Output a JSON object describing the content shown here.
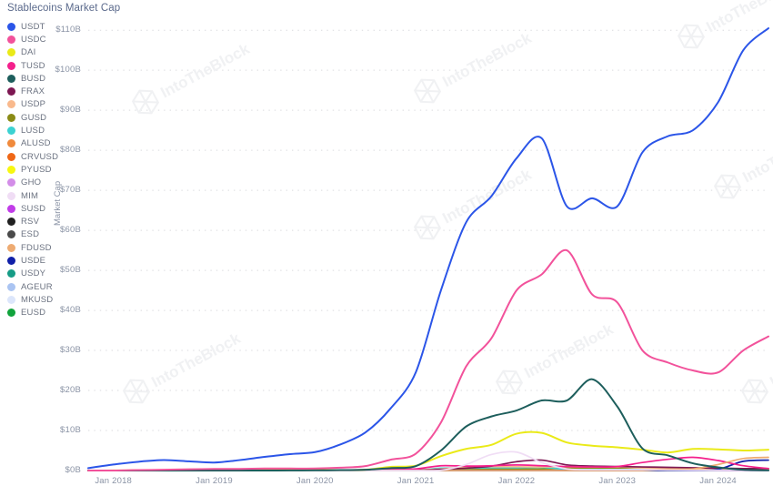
{
  "title": "Stablecoins Market Cap",
  "watermark": "IntoTheBlock",
  "axis": {
    "ylabel": "Market Cap",
    "yticks": [
      "$0B",
      "$10B",
      "$20B",
      "$30B",
      "$40B",
      "$50B",
      "$60B",
      "$70B",
      "$80B",
      "$90B",
      "$100B",
      "$110B"
    ],
    "xticks": [
      "Jan 2018",
      "Jan 2019",
      "Jan 2020",
      "Jan 2021",
      "Jan 2022",
      "Jan 2023",
      "Jan 2024"
    ]
  },
  "legend": [
    {
      "label": "USDT",
      "color": "#2b55e8"
    },
    {
      "label": "USDC",
      "color": "#f2529b"
    },
    {
      "label": "DAI",
      "color": "#eaea18"
    },
    {
      "label": "TUSD",
      "color": "#f4208c"
    },
    {
      "label": "BUSD",
      "color": "#1d5e5c"
    },
    {
      "label": "FRAX",
      "color": "#7d1752"
    },
    {
      "label": "USDP",
      "color": "#f9b98c"
    },
    {
      "label": "GUSD",
      "color": "#8a8b16"
    },
    {
      "label": "LUSD",
      "color": "#3cd2d2"
    },
    {
      "label": "ALUSD",
      "color": "#f08a3c"
    },
    {
      "label": "CRVUSD",
      "color": "#ef6716"
    },
    {
      "label": "PYUSD",
      "color": "#f7f711"
    },
    {
      "label": "GHO",
      "color": "#d38de8"
    },
    {
      "label": "MIM",
      "color": "#f0ddf5"
    },
    {
      "label": "SUSD",
      "color": "#c13ce8"
    },
    {
      "label": "RSV",
      "color": "#202020"
    },
    {
      "label": "ESD",
      "color": "#4a4a4a"
    },
    {
      "label": "FDUSD",
      "color": "#eeab72"
    },
    {
      "label": "USDE",
      "color": "#101fa8"
    },
    {
      "label": "USDY",
      "color": "#169c86"
    },
    {
      "label": "AGEUR",
      "color": "#aac4f2"
    },
    {
      "label": "MKUSD",
      "color": "#dce6fb"
    },
    {
      "label": "EUSD",
      "color": "#11a33c"
    }
  ],
  "chart_data": {
    "type": "line",
    "title": "Stablecoins Market Cap",
    "xlabel": "",
    "ylabel": "Market Cap",
    "ylim": [
      0,
      113
    ],
    "xlim": [
      "2017-10",
      "2024-06"
    ],
    "grid": true,
    "legend_position": "left",
    "units": "billions USD",
    "x": [
      "2017-10",
      "2018-01",
      "2018-04",
      "2018-07",
      "2018-10",
      "2019-01",
      "2019-04",
      "2019-07",
      "2019-10",
      "2020-01",
      "2020-04",
      "2020-07",
      "2020-10",
      "2021-01",
      "2021-04",
      "2021-07",
      "2021-10",
      "2022-01",
      "2022-04",
      "2022-07",
      "2022-10",
      "2023-01",
      "2023-04",
      "2023-07",
      "2023-10",
      "2024-01",
      "2024-04",
      "2024-06"
    ],
    "series": [
      {
        "name": "USDT",
        "color": "#2b55e8",
        "values": [
          0.6,
          1.5,
          2.2,
          2.6,
          2.3,
          2.0,
          2.6,
          3.4,
          4.1,
          4.6,
          6.5,
          9.5,
          15.5,
          24.5,
          45.0,
          62.0,
          68.5,
          78.0,
          83.0,
          66.0,
          68.0,
          66.0,
          79.5,
          83.5,
          85.0,
          92.0,
          105.0,
          110.5
        ]
      },
      {
        "name": "USDC",
        "color": "#f2529b",
        "values": [
          0,
          0,
          0.1,
          0.2,
          0.3,
          0.4,
          0.4,
          0.5,
          0.5,
          0.5,
          0.7,
          1.1,
          2.7,
          4.2,
          12.0,
          26.0,
          33.0,
          45.0,
          49.0,
          55.0,
          44.0,
          42.0,
          30.0,
          27.0,
          25.0,
          24.5,
          30.0,
          33.5
        ]
      },
      {
        "name": "DAI",
        "color": "#eaea18",
        "values": [
          0,
          0.02,
          0.05,
          0.06,
          0.07,
          0.08,
          0.08,
          0.08,
          0.1,
          0.12,
          0.12,
          0.2,
          0.9,
          1.2,
          3.6,
          5.4,
          6.4,
          9.2,
          9.4,
          7.0,
          6.2,
          5.8,
          5.2,
          4.5,
          5.4,
          5.3,
          5.0,
          5.2
        ]
      },
      {
        "name": "TUSD",
        "color": "#f4208c",
        "values": [
          0,
          0,
          0.08,
          0.11,
          0.2,
          0.2,
          0.2,
          0.2,
          0.2,
          0.18,
          0.13,
          0.2,
          0.3,
          0.4,
          1.2,
          1.1,
          1.2,
          1.4,
          1.2,
          1.0,
          0.9,
          1.0,
          2.0,
          2.8,
          3.3,
          2.5,
          1.2,
          0.5
        ]
      },
      {
        "name": "BUSD",
        "color": "#1d5e5c",
        "values": [
          0,
          0,
          0,
          0,
          0,
          0,
          0,
          0,
          0.02,
          0.05,
          0.1,
          0.2,
          0.6,
          1.1,
          5.0,
          11.0,
          13.5,
          15.0,
          17.5,
          17.5,
          22.8,
          16.0,
          5.5,
          3.8,
          1.8,
          0.8,
          0.2,
          0.05
        ]
      },
      {
        "name": "FRAX",
        "color": "#7d1752",
        "values": [
          0,
          0,
          0,
          0,
          0,
          0,
          0,
          0,
          0,
          0,
          0,
          0,
          0.1,
          0.1,
          0.3,
          0.6,
          1.1,
          2.2,
          2.6,
          1.4,
          1.1,
          1.0,
          0.9,
          0.8,
          0.7,
          0.6,
          0.5,
          0.5
        ]
      },
      {
        "name": "USDP",
        "color": "#f9b98c",
        "values": [
          0,
          0,
          0,
          0,
          0,
          0,
          0.01,
          0.02,
          0.03,
          0.05,
          0.08,
          0.1,
          0.14,
          0.15,
          0.4,
          0.9,
          0.95,
          0.95,
          0.9,
          0.95,
          0.9,
          0.9,
          0.6,
          0.5,
          0.4,
          0.4,
          0.4,
          0.35
        ]
      },
      {
        "name": "GUSD",
        "color": "#8a8b16",
        "values": [
          0,
          0,
          0.08,
          0.09,
          0.09,
          0.1,
          0.08,
          0.05,
          0.04,
          0.05,
          0.05,
          0.06,
          0.1,
          0.15,
          0.2,
          0.3,
          0.3,
          0.3,
          0.4,
          0.6,
          0.6,
          0.6,
          0.3,
          0.12,
          0.1,
          0.1,
          0.1,
          0.1
        ]
      },
      {
        "name": "LUSD",
        "color": "#3cd2d2",
        "values": [
          0,
          0,
          0,
          0,
          0,
          0,
          0,
          0,
          0,
          0,
          0,
          0,
          0,
          0,
          0.6,
          0.6,
          0.7,
          0.7,
          0.8,
          0.3,
          0.25,
          0.25,
          0.28,
          0.28,
          0.28,
          0.28,
          0.25,
          0.08
        ]
      },
      {
        "name": "ALUSD",
        "color": "#f08a3c",
        "values": [
          0,
          0,
          0,
          0,
          0,
          0,
          0,
          0,
          0,
          0,
          0,
          0,
          0,
          0,
          0.1,
          0.3,
          0.4,
          0.4,
          0.3,
          0.2,
          0.2,
          0.2,
          0.2,
          0.2,
          0.2,
          0.2,
          0.2,
          0.2
        ]
      },
      {
        "name": "CRVUSD",
        "color": "#ef6716",
        "values": [
          0,
          0,
          0,
          0,
          0,
          0,
          0,
          0,
          0,
          0,
          0,
          0,
          0,
          0,
          0,
          0,
          0,
          0,
          0,
          0,
          0,
          0,
          0.05,
          0.1,
          0.12,
          0.13,
          0.1,
          0.1
        ]
      },
      {
        "name": "PYUSD",
        "color": "#f7f711",
        "values": [
          0,
          0,
          0,
          0,
          0,
          0,
          0,
          0,
          0,
          0,
          0,
          0,
          0,
          0,
          0,
          0,
          0,
          0,
          0,
          0,
          0,
          0,
          0,
          0.03,
          0.15,
          0.3,
          0.35,
          0.4
        ]
      },
      {
        "name": "GHO",
        "color": "#d38de8",
        "values": [
          0,
          0,
          0,
          0,
          0,
          0,
          0,
          0,
          0,
          0,
          0,
          0,
          0,
          0,
          0,
          0,
          0,
          0,
          0,
          0,
          0,
          0,
          0,
          0.02,
          0.03,
          0.03,
          0.05,
          0.05
        ]
      },
      {
        "name": "MIM",
        "color": "#f0ddf5",
        "values": [
          0,
          0,
          0,
          0,
          0,
          0,
          0,
          0,
          0,
          0,
          0,
          0,
          0,
          0,
          0.05,
          1.5,
          4.0,
          4.6,
          2.0,
          0.4,
          0.2,
          0.2,
          0.2,
          0.1,
          0.05,
          0.05,
          0.03,
          0.03
        ]
      },
      {
        "name": "SUSD",
        "color": "#c13ce8",
        "values": [
          0,
          0,
          0,
          0,
          0.01,
          0.01,
          0.01,
          0.02,
          0.02,
          0.02,
          0.03,
          0.05,
          0.08,
          0.1,
          0.12,
          0.12,
          0.12,
          0.12,
          0.1,
          0.08,
          0.06,
          0.05,
          0.05,
          0.04,
          0.03,
          0.03,
          0.02,
          0.02
        ]
      },
      {
        "name": "RSV",
        "color": "#202020",
        "values": [
          0,
          0,
          0,
          0,
          0,
          0,
          0,
          0,
          0,
          0,
          0,
          0,
          0,
          0,
          0,
          0,
          0,
          0,
          0,
          0,
          0,
          0,
          0,
          0,
          0,
          0,
          0,
          0
        ]
      },
      {
        "name": "ESD",
        "color": "#4a4a4a",
        "values": [
          0,
          0,
          0,
          0,
          0,
          0,
          0,
          0,
          0,
          0,
          0,
          0,
          0.02,
          0.02,
          0.01,
          0,
          0,
          0,
          0,
          0,
          0,
          0,
          0,
          0,
          0,
          0,
          0,
          0
        ]
      },
      {
        "name": "FDUSD",
        "color": "#eeab72",
        "values": [
          0,
          0,
          0,
          0,
          0,
          0,
          0,
          0,
          0,
          0,
          0,
          0,
          0,
          0,
          0,
          0,
          0,
          0,
          0,
          0,
          0,
          0,
          0,
          0.3,
          0.4,
          1.5,
          3.0,
          3.3
        ]
      },
      {
        "name": "USDE",
        "color": "#101fa8",
        "values": [
          0,
          0,
          0,
          0,
          0,
          0,
          0,
          0,
          0,
          0,
          0,
          0,
          0,
          0,
          0,
          0,
          0,
          0,
          0,
          0,
          0,
          0,
          0,
          0,
          0,
          0.3,
          2.3,
          2.6
        ]
      },
      {
        "name": "USDY",
        "color": "#169c86",
        "values": [
          0,
          0,
          0,
          0,
          0,
          0,
          0,
          0,
          0,
          0,
          0,
          0,
          0,
          0,
          0,
          0,
          0,
          0,
          0,
          0,
          0,
          0,
          0,
          0,
          0.02,
          0.05,
          0.1,
          0.15
        ]
      },
      {
        "name": "AGEUR",
        "color": "#aac4f2",
        "values": [
          0,
          0,
          0,
          0,
          0,
          0,
          0,
          0,
          0,
          0,
          0,
          0,
          0,
          0,
          0.05,
          0.1,
          0.2,
          0.2,
          0.2,
          0.18,
          0.15,
          0.15,
          0.12,
          0.1,
          0.08,
          0.06,
          0.05,
          0.05
        ]
      },
      {
        "name": "MKUSD",
        "color": "#dce6fb",
        "values": [
          0,
          0,
          0,
          0,
          0,
          0,
          0,
          0,
          0,
          0,
          0,
          0,
          0,
          0,
          0,
          0,
          0,
          0,
          0,
          0,
          0,
          0,
          0,
          0,
          0.05,
          0.1,
          0.1,
          0.08
        ]
      },
      {
        "name": "EUSD",
        "color": "#11a33c",
        "values": [
          0,
          0,
          0,
          0,
          0,
          0,
          0,
          0,
          0,
          0,
          0,
          0,
          0,
          0,
          0,
          0,
          0,
          0,
          0,
          0,
          0,
          0.05,
          0.1,
          0.1,
          0.1,
          0.1,
          0.1,
          0.1
        ]
      }
    ]
  }
}
